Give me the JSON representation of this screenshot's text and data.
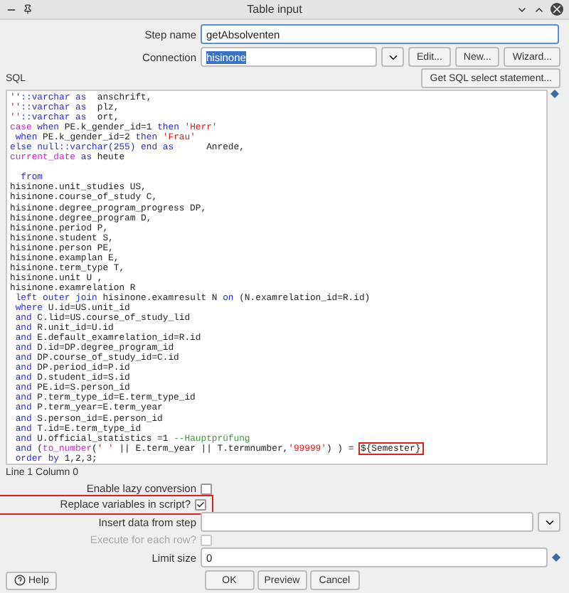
{
  "window": {
    "title": "Table input"
  },
  "step_name": {
    "label": "Step name",
    "value": "getAbsolventen"
  },
  "connection": {
    "label": "Connection",
    "value": "hisinone",
    "selected": true,
    "buttons": [
      "Edit...",
      "New...",
      "Wizard..."
    ]
  },
  "sql": {
    "label": "SQL",
    "get_button": "Get SQL select statement...",
    "lines": [
      [
        {
          "kind": "string",
          "text": "''"
        },
        {
          "kind": "keyword",
          "text": "::varchar as"
        },
        {
          "kind": "plain",
          "text": "  anschrift,"
        }
      ],
      [
        {
          "kind": "string",
          "text": "''"
        },
        {
          "kind": "keyword",
          "text": "::varchar as"
        },
        {
          "kind": "plain",
          "text": "  plz,"
        }
      ],
      [
        {
          "kind": "string",
          "text": "''"
        },
        {
          "kind": "keyword",
          "text": "::varchar as"
        },
        {
          "kind": "plain",
          "text": "  ort,"
        }
      ],
      [
        {
          "kind": "function",
          "text": "case"
        },
        {
          "kind": "keyword",
          "text": " when"
        },
        {
          "kind": "plain",
          "text": " PE.k_gender_id=1 "
        },
        {
          "kind": "keyword",
          "text": "then"
        },
        {
          "kind": "string",
          "text": " 'Herr'"
        }
      ],
      [
        {
          "kind": "keyword",
          "text": " when"
        },
        {
          "kind": "plain",
          "text": " PE.k_gender_id=2 "
        },
        {
          "kind": "keyword",
          "text": "then"
        },
        {
          "kind": "string",
          "text": " 'Frau'"
        }
      ],
      [
        {
          "kind": "keyword",
          "text": "else null::varchar(255) end as"
        },
        {
          "kind": "plain",
          "text": "      Anrede,"
        }
      ],
      [
        {
          "kind": "function",
          "text": "current_date"
        },
        {
          "kind": "keyword",
          "text": " as"
        },
        {
          "kind": "plain",
          "text": " heute"
        }
      ],
      [
        {
          "kind": "blank"
        }
      ],
      [
        {
          "kind": "keyword",
          "text": "  from"
        }
      ],
      [
        {
          "kind": "plain",
          "text": "hisinone.unit_studies US,"
        }
      ],
      [
        {
          "kind": "plain",
          "text": "hisinone.course_of_study C,"
        }
      ],
      [
        {
          "kind": "plain",
          "text": "hisinone.degree_program_progress DP,"
        }
      ],
      [
        {
          "kind": "plain",
          "text": "hisinone.degree_program D,"
        }
      ],
      [
        {
          "kind": "plain",
          "text": "hisinone.period P,"
        }
      ],
      [
        {
          "kind": "plain",
          "text": "hisinone.student S,"
        }
      ],
      [
        {
          "kind": "plain",
          "text": "hisinone.person PE,"
        }
      ],
      [
        {
          "kind": "plain",
          "text": "hisinone.examplan E,"
        }
      ],
      [
        {
          "kind": "plain",
          "text": "hisinone.term_type T,"
        }
      ],
      [
        {
          "kind": "plain",
          "text": "hisinone.unit U ,"
        }
      ],
      [
        {
          "kind": "plain",
          "text": "hisinone.examrelation R"
        }
      ],
      [
        {
          "kind": "keyword",
          "text": " left outer join"
        },
        {
          "kind": "plain",
          "text": " hisinone.examresult N "
        },
        {
          "kind": "keyword",
          "text": "on"
        },
        {
          "kind": "plain",
          "text": " (N.examrelation_id=R.id)"
        }
      ],
      [
        {
          "kind": "keyword",
          "text": " where"
        },
        {
          "kind": "plain",
          "text": " U.id=US.unit_id"
        }
      ],
      [
        {
          "kind": "keyword",
          "text": " and"
        },
        {
          "kind": "plain",
          "text": " C.lid=US.course_of_study_lid"
        }
      ],
      [
        {
          "kind": "keyword",
          "text": " and"
        },
        {
          "kind": "plain",
          "text": " R.unit_id=U.id"
        }
      ],
      [
        {
          "kind": "keyword",
          "text": " and"
        },
        {
          "kind": "plain",
          "text": " E.default_examrelation_id=R.id"
        }
      ],
      [
        {
          "kind": "keyword",
          "text": " and"
        },
        {
          "kind": "plain",
          "text": " D.id=DP.degree_program_id"
        }
      ],
      [
        {
          "kind": "keyword",
          "text": " and"
        },
        {
          "kind": "plain",
          "text": " DP.course_of_study_id=C.id"
        }
      ],
      [
        {
          "kind": "keyword",
          "text": " and"
        },
        {
          "kind": "plain",
          "text": " DP.period_id=P.id"
        }
      ],
      [
        {
          "kind": "keyword",
          "text": " and"
        },
        {
          "kind": "plain",
          "text": " D.student_id=S.id"
        }
      ],
      [
        {
          "kind": "keyword",
          "text": " and"
        },
        {
          "kind": "plain",
          "text": " PE.id=S.person_id"
        }
      ],
      [
        {
          "kind": "keyword",
          "text": " and"
        },
        {
          "kind": "plain",
          "text": " P.term_type_id=E.term_type_id"
        }
      ],
      [
        {
          "kind": "keyword",
          "text": " and"
        },
        {
          "kind": "plain",
          "text": " P.term_year=E.term_year"
        }
      ],
      [
        {
          "kind": "keyword",
          "text": " and"
        },
        {
          "kind": "plain",
          "text": " S.person_id=E.person_id"
        }
      ],
      [
        {
          "kind": "keyword",
          "text": " and"
        },
        {
          "kind": "plain",
          "text": " T.id=E.term_type_id"
        }
      ],
      [
        {
          "kind": "keyword",
          "text": " and"
        },
        {
          "kind": "plain",
          "text": " U.official_statistics =1 "
        },
        {
          "kind": "comment",
          "text": "--Hauptprüfung"
        }
      ],
      [
        {
          "kind": "keyword",
          "text": " and"
        },
        {
          "kind": "plain",
          "text": " ("
        },
        {
          "kind": "function",
          "text": "to_number"
        },
        {
          "kind": "plain",
          "text": "("
        },
        {
          "kind": "string",
          "text": "' '"
        },
        {
          "kind": "plain",
          "text": " || E.term_year || T.termnumber,"
        },
        {
          "kind": "string",
          "text": "'99999'"
        },
        {
          "kind": "plain",
          "text": ") ) = "
        },
        {
          "kind": "plain",
          "text": "${Semester}",
          "highlighted": true
        }
      ],
      [
        {
          "kind": "keyword",
          "text": " order by"
        },
        {
          "kind": "plain",
          "text": " 1,2,3;"
        }
      ]
    ]
  },
  "status": "Line 1 Column 0",
  "options": [
    {
      "kind": "checkbox",
      "label": "Enable lazy conversion",
      "checked": false,
      "disabled": false,
      "highlighted": false
    },
    {
      "kind": "checkbox",
      "label": "Replace variables in script?",
      "checked": true,
      "disabled": false,
      "highlighted": true
    },
    {
      "kind": "dropdown",
      "label": "Insert data from step"
    },
    {
      "kind": "checkbox",
      "label": "Execute for each row?",
      "checked": false,
      "disabled": true,
      "highlighted": false
    },
    {
      "kind": "field",
      "label": "Limit size",
      "value": "0"
    }
  ],
  "footer": {
    "help": "Help",
    "buttons": [
      "OK",
      "Preview",
      "Cancel"
    ]
  }
}
